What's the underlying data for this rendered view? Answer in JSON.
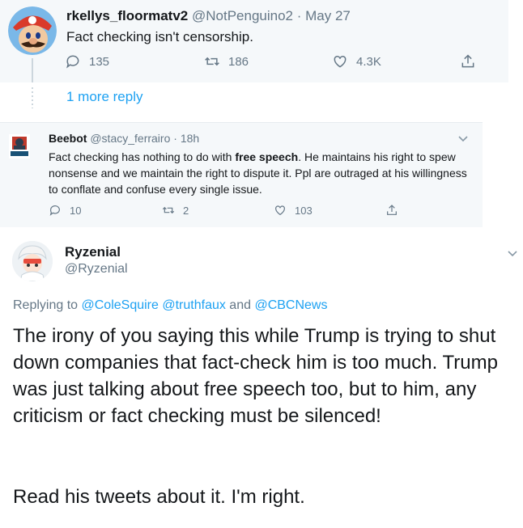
{
  "tweet1": {
    "display_name": "rkellys_floormatv2",
    "handle": "@NotPenguino2",
    "separator": "·",
    "date": "May 27",
    "text": "Fact checking isn't censorship.",
    "reply_count": "135",
    "retweet_count": "186",
    "like_count": "4.3K"
  },
  "more_replies": {
    "label": "1 more reply"
  },
  "tweet2": {
    "display_name": "Beebot",
    "handle": "@stacy_ferrairo",
    "separator": "·",
    "date": "18h",
    "text_before": "Fact checking has nothing to do with ",
    "text_bold": "free speech",
    "text_after": ". He maintains his right to spew nonsense and we maintain the right to dispute it. Ppl are outraged at his willingness to conflate and confuse every single issue.",
    "reply_count": "10",
    "retweet_count": "2",
    "like_count": "103"
  },
  "tweet3": {
    "display_name": "Ryzenial",
    "handle": "@Ryzenial",
    "replying_prefix": "Replying to ",
    "mention_1": "@ColeSquire",
    "mention_2": "@truthfaux",
    "and_word": " and ",
    "mention_3": "@CBCNews",
    "body_paragraph_1": "The irony of you saying this while Trump is trying to shut down companies that fact-check him is too much. Trump was just talking about free speech too, but to him, any criticism or fact checking must be silenced!",
    "body_paragraph_2": "Read his tweets about it. I'm right."
  },
  "colors": {
    "link": "#1da1f2",
    "muted": "#657786",
    "card_background": "#f5f8fa",
    "text": "#14171a"
  }
}
